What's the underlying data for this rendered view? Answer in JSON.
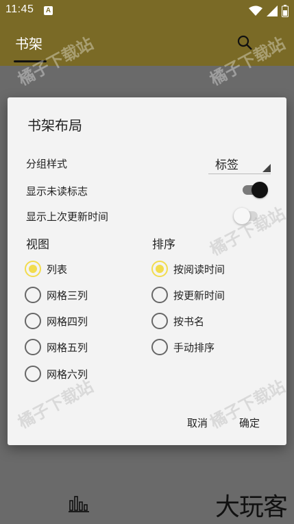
{
  "status_bar": {
    "time": "11:45",
    "app_icon_letter": "A"
  },
  "app_bar": {
    "title": "书架"
  },
  "dialog": {
    "title": "书架布局",
    "group_style": {
      "label": "分组样式",
      "value": "标签"
    },
    "show_unread": {
      "label": "显示未读标志",
      "on": true
    },
    "show_last_update": {
      "label": "显示上次更新时间",
      "on": false
    },
    "view": {
      "title": "视图",
      "options": [
        "列表",
        "网格三列",
        "网格四列",
        "网格五列",
        "网格六列"
      ],
      "selected": 0
    },
    "sort": {
      "title": "排序",
      "options": [
        "按阅读时间",
        "按更新时间",
        "按书名",
        "手动排序"
      ],
      "selected": 0
    },
    "cancel_label": "取消",
    "confirm_label": "确定"
  },
  "brand": "大玩客",
  "watermark": "橘子下载站",
  "colors": {
    "app_bar": "#7a6a26",
    "accent": "#f2dc4d",
    "scrim": "#6a6a6a"
  }
}
